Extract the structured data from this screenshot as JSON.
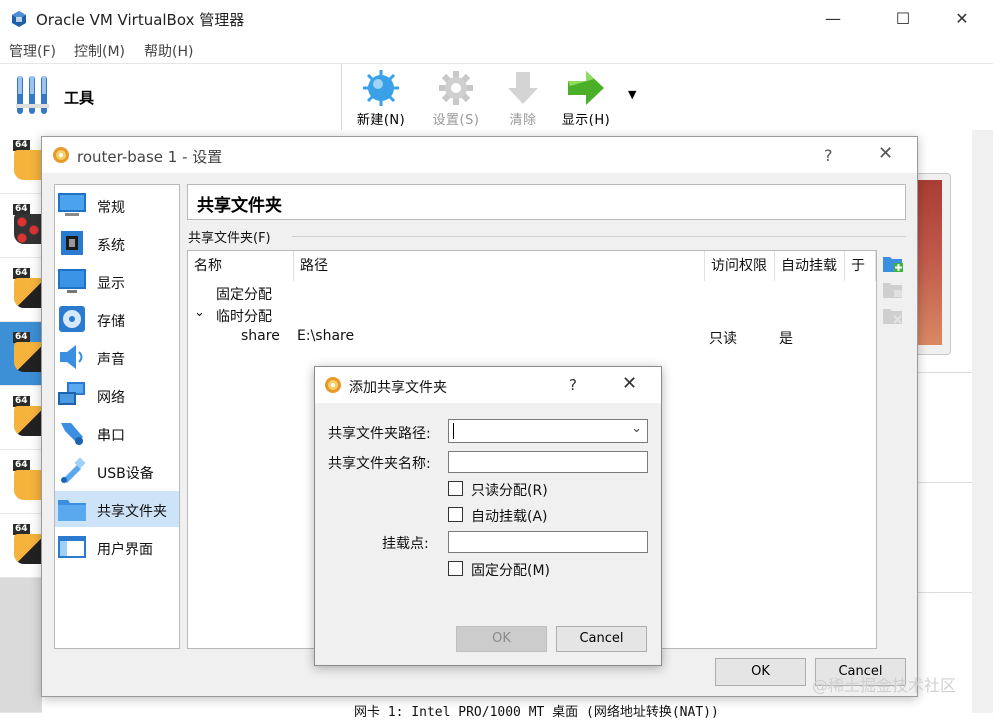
{
  "window": {
    "title": "Oracle VM VirtualBox 管理器",
    "minimize": "—",
    "maximize": "☐",
    "close": "✕"
  },
  "menubar": {
    "items": [
      "管理(F)",
      "控制(M)",
      "帮助(H)"
    ]
  },
  "toolbar": {
    "tools_label": "工具",
    "new_label": "新建(N)",
    "settings_label": "设置(S)",
    "discard_label": "清除",
    "show_label": "显示(H)"
  },
  "vm_list": {
    "badge": "64",
    "selected_index": 3
  },
  "details": {
    "network_line": "网卡 1:  Intel PRO/1000 MT 桌面 (网络地址转换(NAT))"
  },
  "settings_dialog": {
    "title": "router-base 1 - 设置",
    "help": "?",
    "close": "✕",
    "categories": [
      "常规",
      "系统",
      "显示",
      "存储",
      "声音",
      "网络",
      "串口",
      "USB设备",
      "共享文件夹",
      "用户界面"
    ],
    "selected_category": "共享文件夹",
    "section_title": "共享文件夹",
    "group_label": "共享文件夹(F)",
    "table": {
      "headers": [
        "名称",
        "路径",
        "访问权限",
        "自动挂载",
        "于"
      ],
      "groups": [
        {
          "label": "固定分配",
          "expanded": false
        },
        {
          "label": "临时分配",
          "expanded": true
        }
      ],
      "rows": [
        {
          "name": "share",
          "path": "E:\\share",
          "access": "只读",
          "automount": "是"
        }
      ]
    },
    "ok": "OK",
    "cancel": "Cancel"
  },
  "add_share_dialog": {
    "title": "添加共享文件夹",
    "help": "?",
    "close": "✕",
    "path_label": "共享文件夹路径:",
    "path_value": "",
    "name_label": "共享文件夹名称:",
    "name_value": "",
    "readonly_label": "只读分配(R)",
    "automount_label": "自动挂载(A)",
    "mountpoint_label": "挂载点:",
    "mountpoint_value": "",
    "permanent_label": "固定分配(M)",
    "ok": "OK",
    "cancel": "Cancel"
  },
  "watermark": "@稀土掘金技术社区",
  "colors": {
    "selection": "#3d8fd6",
    "category_selected": "#cde3f7",
    "new_icon": "#3aa0e8",
    "show_icon": "#4caf2a",
    "disabled_icon": "#c8c8c8"
  }
}
